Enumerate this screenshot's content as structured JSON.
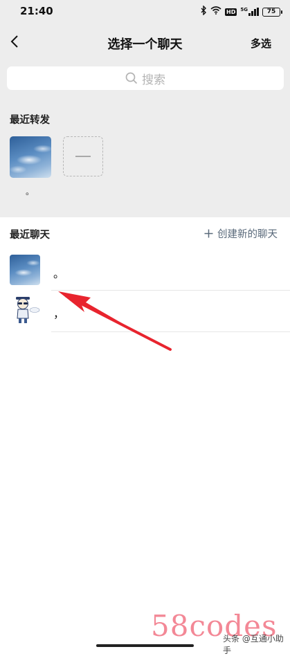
{
  "status_bar": {
    "time": "21:40",
    "network": "5G",
    "hd": "HD",
    "battery": "75"
  },
  "nav": {
    "title": "选择一个聊天",
    "multi_select": "多选"
  },
  "search": {
    "placeholder": "搜索"
  },
  "recent_forward": {
    "label": "最近转发",
    "items": [
      {
        "caption": "。"
      }
    ]
  },
  "recent_chats": {
    "label": "最近聊天",
    "create_new": "创建新的聊天",
    "items": [
      {
        "name": "。"
      },
      {
        "name": "，"
      }
    ]
  },
  "watermark": {
    "logo": "58codes",
    "text": "头条 @互通小助手"
  },
  "colors": {
    "accent_arrow": "#e8242e",
    "link": "#59697a",
    "background_top": "#ededed"
  },
  "icons": [
    "bluetooth-icon",
    "wifi-icon",
    "signal-icon",
    "battery-icon",
    "back-chevron-icon",
    "search-icon",
    "plus-icon",
    "red-arrow-annotation"
  ]
}
